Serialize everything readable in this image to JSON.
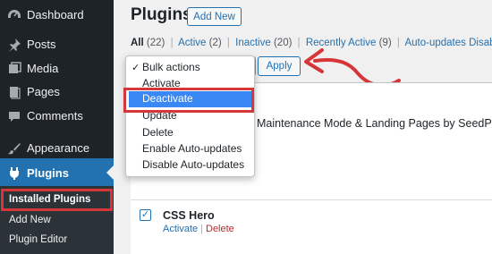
{
  "sidebar": {
    "items": [
      {
        "label": "Dashboard",
        "icon": "dashboard-icon"
      },
      {
        "label": "Posts",
        "icon": "pin-icon"
      },
      {
        "label": "Media",
        "icon": "media-icon"
      },
      {
        "label": "Pages",
        "icon": "pages-icon"
      },
      {
        "label": "Comments",
        "icon": "comment-icon"
      },
      {
        "label": "Appearance",
        "icon": "brush-icon"
      },
      {
        "label": "Plugins",
        "icon": "plugin-icon"
      }
    ],
    "submenu": [
      "Installed Plugins",
      "Add New",
      "Plugin Editor"
    ]
  },
  "header": {
    "title": "Plugins",
    "add_new": "Add New"
  },
  "filters": {
    "all": "All",
    "all_count": "(22)",
    "active": "Active",
    "active_count": "(2)",
    "inactive": "Inactive",
    "inactive_count": "(20)",
    "recently_active": "Recently Active",
    "recently_active_count": "(9)",
    "auto_updates_disabled": "Auto-updates Disabled",
    "separator": "|"
  },
  "bulk": {
    "apply": "Apply",
    "options": [
      "Bulk actions",
      "Activate",
      "Deactivate",
      "Update",
      "Delete",
      "Enable Auto-updates",
      "Disable Auto-updates"
    ],
    "selected": "Bulk actions",
    "highlighted": "Deactivate",
    "check_mark": "✓"
  },
  "table": {
    "partial_plugin_name": "Maintenance Mode & Landing Pages by SeedProd",
    "row": {
      "name": "CSS Hero",
      "checked": true,
      "check_mark": "✓",
      "activate": "Activate",
      "delete": "Delete",
      "separator": "|"
    }
  },
  "colors": {
    "sidebar_bg": "#1d2327",
    "accent": "#2271b1",
    "highlight_box": "#d63638",
    "dropdown_highlight": "#3a88f3"
  }
}
